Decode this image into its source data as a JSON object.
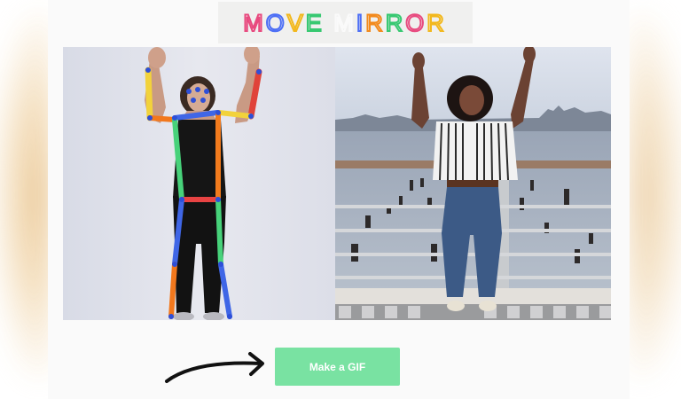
{
  "header": {
    "title": "MOVE MIRROR",
    "letter_colors": [
      "#e84a7f",
      "#4c6ef5",
      "#f2b81d",
      "#37c871",
      "#e84a7f",
      "#fafafa",
      "#4c6ef5",
      "#f28a1d",
      "#37c871",
      "#e84a7f",
      "#f2b81d",
      "#4c6ef5"
    ]
  },
  "left_panel": {
    "image": "user-pose-photo",
    "skeleton_icon": "pose-skeleton-overlay"
  },
  "right_panel": {
    "image": "matched-pose-photo"
  },
  "cta": {
    "arrow_icon": "hand-drawn-arrow",
    "button_label": "Make a GIF",
    "button_color": "#79e2a2"
  }
}
